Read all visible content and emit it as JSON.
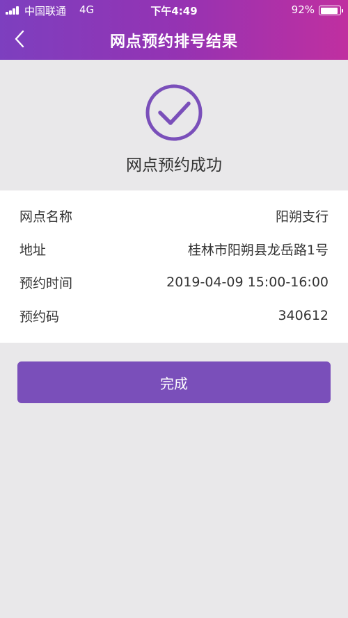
{
  "status_bar": {
    "carrier": "中国联通",
    "network": "4G",
    "time": "下午4:49",
    "battery_percent": "92%",
    "battery_level": 0.92
  },
  "nav": {
    "title": "网点预约排号结果",
    "back_icon": "chevron-left-icon"
  },
  "success": {
    "icon": "check-circle-icon",
    "message": "网点预约成功"
  },
  "info": {
    "rows": [
      {
        "label": "网点名称",
        "value": "阳朔支行"
      },
      {
        "label": "地址",
        "value": "桂林市阳朔县龙岳路1号"
      },
      {
        "label": "预约时间",
        "value": "2019-04-09 15:00-16:00"
      },
      {
        "label": "预约码",
        "value": "340612"
      }
    ]
  },
  "actions": {
    "done_label": "完成"
  },
  "colors": {
    "header_gradient_start": "#7d3fbf",
    "header_gradient_end": "#c02fa0",
    "accent": "#7a4fba",
    "background": "#e9e8ea"
  }
}
